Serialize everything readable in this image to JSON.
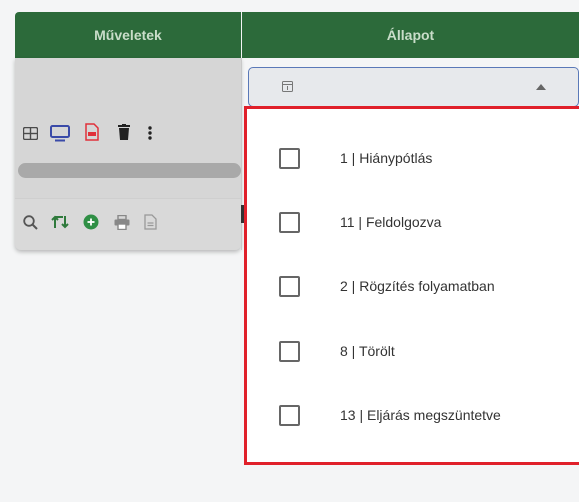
{
  "header": {
    "operations_label": "Műveletek",
    "state_label": "Állapot"
  },
  "colors": {
    "header_bg": "#2c6a3a",
    "header_text": "#c9ddc9",
    "dropdown_border": "#e0202a",
    "select_border": "#5a79b8"
  },
  "toolbar_row1": [
    {
      "icon": "table-icon"
    },
    {
      "icon": "monitor-icon"
    },
    {
      "icon": "pdf-icon"
    },
    {
      "icon": "trash-icon"
    },
    {
      "icon": "more-vertical-icon"
    }
  ],
  "toolbar_row2": [
    {
      "icon": "search-icon"
    },
    {
      "icon": "swap-icon"
    },
    {
      "icon": "add-circle-icon"
    },
    {
      "icon": "print-icon"
    },
    {
      "icon": "document-icon"
    }
  ],
  "status_filter": {
    "options": [
      {
        "label": "1 | Hiánypótlás",
        "checked": false
      },
      {
        "label": "11 | Feldolgozva",
        "checked": false
      },
      {
        "label": "2 | Rögzítés folyamatban",
        "checked": false
      },
      {
        "label": "8 | Törölt",
        "checked": false
      },
      {
        "label": "13 | Eljárás megszüntetve",
        "checked": false
      }
    ]
  }
}
